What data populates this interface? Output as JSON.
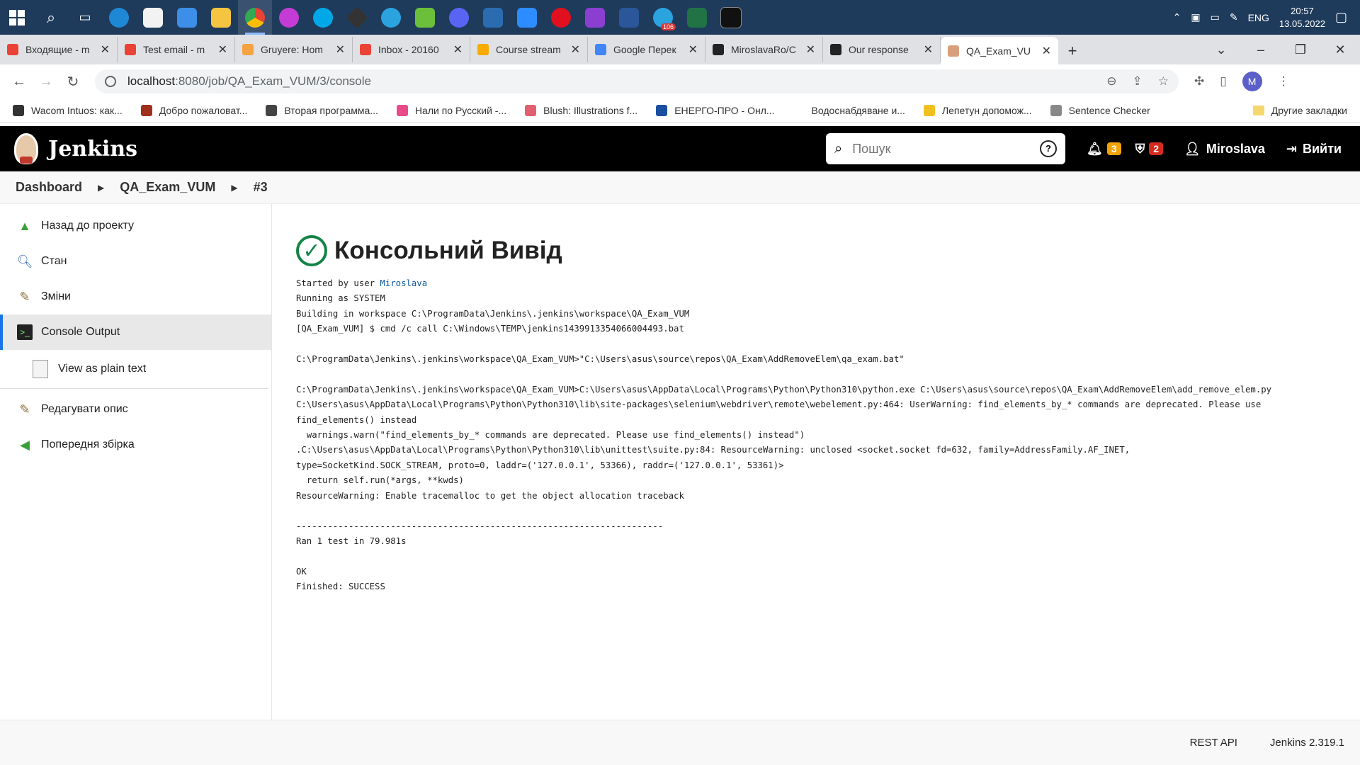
{
  "taskbar": {
    "icons": [
      "start-icon",
      "search-icon",
      "task-view-icon",
      "edge-icon",
      "store-icon",
      "mail-icon",
      "explorer-icon",
      "chrome-icon",
      "app-icon",
      "skype-icon",
      "app-icon",
      "telegram-icon",
      "app-icon",
      "discord-icon",
      "app-icon",
      "zoom-icon",
      "opera-icon",
      "visual-studio-icon",
      "word-icon",
      "telegram-icon",
      "excel-icon",
      "terminal-icon"
    ],
    "telegram_badge": "106",
    "lang": "ENG",
    "time": "20:57",
    "date": "13.05.2022"
  },
  "tabs": [
    {
      "title": "Входящие - m",
      "icon": "gmail-icon",
      "color": "#ea4335"
    },
    {
      "title": "Test email - m",
      "icon": "gmail-icon",
      "color": "#ea4335"
    },
    {
      "title": "Gruyere: Hom",
      "icon": "gruyere-icon",
      "color": "#f4a340"
    },
    {
      "title": "Inbox - 20160",
      "icon": "gmail-icon",
      "color": "#ea4335"
    },
    {
      "title": "Course stream",
      "icon": "classroom-icon",
      "color": "#f9ab00"
    },
    {
      "title": "Google Перек",
      "icon": "translate-icon",
      "color": "#4285f4"
    },
    {
      "title": "MiroslavaRo/C",
      "icon": "github-icon",
      "color": "#222222"
    },
    {
      "title": "Our response",
      "icon": "github-icon",
      "color": "#222222"
    },
    {
      "title": "QA_Exam_VU",
      "icon": "jenkins-icon",
      "color": "#d8a07a"
    }
  ],
  "browser": {
    "url_host": "localhost",
    "url_rest": ":8080/job/QA_Exam_VUM/3/console",
    "profile": "M"
  },
  "bookmarks": [
    {
      "label": "Wacom Intuos: как...",
      "color": "#333333"
    },
    {
      "label": "Добро пожаловат...",
      "color": "#a0301e"
    },
    {
      "label": "Вторая программа...",
      "color": "#444444"
    },
    {
      "label": "Нали по Русский -...",
      "color": "#e84a8a"
    },
    {
      "label": "Blush: Illustrations f...",
      "color": "#e06070"
    },
    {
      "label": "ЕНЕРГО-ПРО - Онл...",
      "color": "#1a4fa0"
    },
    {
      "label": "Водоснабдяване и...",
      "color": "#ffffff"
    },
    {
      "label": "Лепетун допомож...",
      "color": "#f0c020"
    },
    {
      "label": "Sentence Checker",
      "color": "#888888"
    }
  ],
  "bookmarks_other": "Другие закладки",
  "jenkins": {
    "name": "Jenkins",
    "search_placeholder": "Пошук",
    "notifications": "3",
    "security": "2",
    "user": "Miroslava",
    "logout": "Вийти"
  },
  "breadcrumb": [
    "Dashboard",
    "QA_Exam_VUM",
    "#3"
  ],
  "sidebar": {
    "back": "Назад до проекту",
    "status": "Стан",
    "changes": "Зміни",
    "console": "Console Output",
    "plain": "View as plain text",
    "edit": "Редагувати опис",
    "previous": "Попередня збірка"
  },
  "main": {
    "title": "Консольний Вивід",
    "started_prefix": "Started by user ",
    "started_user": "Miroslava",
    "log": "Running as SYSTEM\nBuilding in workspace C:\\ProgramData\\Jenkins\\.jenkins\\workspace\\QA_Exam_VUM\n[QA_Exam_VUM] $ cmd /c call C:\\Windows\\TEMP\\jenkins1439913354066004493.bat\n\nC:\\ProgramData\\Jenkins\\.jenkins\\workspace\\QA_Exam_VUM>\"C:\\Users\\asus\\source\\repos\\QA_Exam\\AddRemoveElem\\qa_exam.bat\"\n\nC:\\ProgramData\\Jenkins\\.jenkins\\workspace\\QA_Exam_VUM>C:\\Users\\asus\\AppData\\Local\\Programs\\Python\\Python310\\python.exe C:\\Users\\asus\\source\\repos\\QA_Exam\\AddRemoveElem\\add_remove_elem.py\nC:\\Users\\asus\\AppData\\Local\\Programs\\Python\\Python310\\lib\\site-packages\\selenium\\webdriver\\remote\\webelement.py:464: UserWarning: find_elements_by_* commands are deprecated. Please use\nfind_elements() instead\n  warnings.warn(\"find_elements_by_* commands are deprecated. Please use find_elements() instead\")\n.C:\\Users\\asus\\AppData\\Local\\Programs\\Python\\Python310\\lib\\unittest\\suite.py:84: ResourceWarning: unclosed <socket.socket fd=632, family=AddressFamily.AF_INET,\ntype=SocketKind.SOCK_STREAM, proto=0, laddr=('127.0.0.1', 53366), raddr=('127.0.0.1', 53361)>\n  return self.run(*args, **kwds)\nResourceWarning: Enable tracemalloc to get the object allocation traceback\n\n----------------------------------------------------------------------\nRan 1 test in 79.981s\n\nOK\nFinished: SUCCESS"
  },
  "footer": {
    "rest_api": "REST API",
    "version": "Jenkins 2.319.1"
  },
  "colors": {
    "success_green": "#138347",
    "link_blue": "#0b57a0",
    "active_border": "#1a73e8"
  }
}
